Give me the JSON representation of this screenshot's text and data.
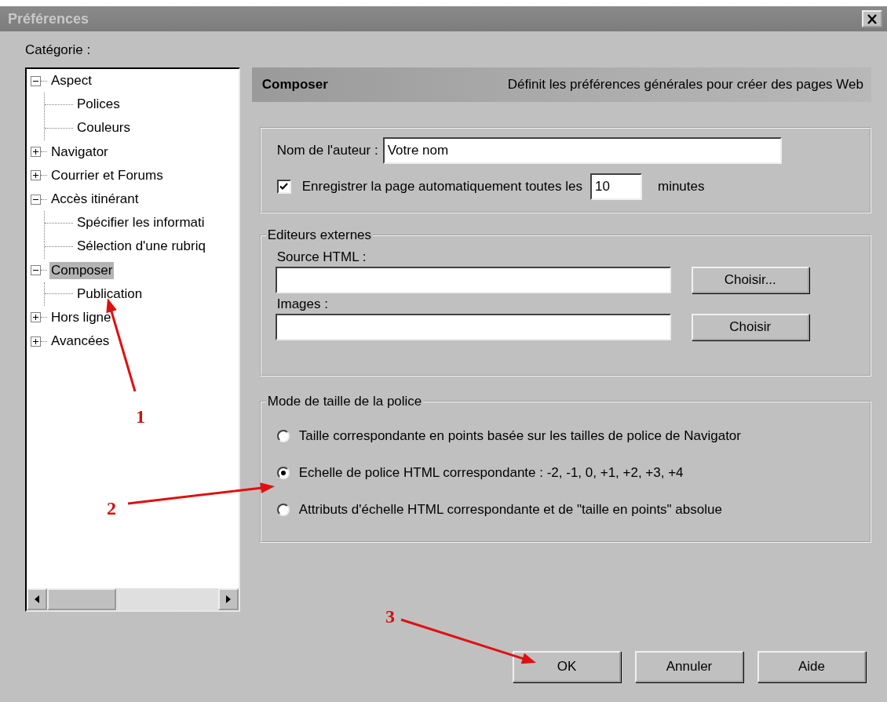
{
  "window": {
    "title": "Préférences"
  },
  "category_label": "Catégorie :",
  "tree": {
    "items": [
      {
        "label": "Aspect",
        "expanded": true,
        "selected": false,
        "children": [
          {
            "label": "Polices",
            "selected": false
          },
          {
            "label": "Couleurs",
            "selected": false
          }
        ]
      },
      {
        "label": "Navigator",
        "expanded": false,
        "selected": false
      },
      {
        "label": "Courrier et Forums",
        "expanded": false,
        "selected": false
      },
      {
        "label": "Accès itinérant",
        "expanded": true,
        "selected": false,
        "children": [
          {
            "label": "Spécifier les informati",
            "selected": false
          },
          {
            "label": "Sélection d'une rubriq",
            "selected": false
          }
        ]
      },
      {
        "label": "Composer",
        "expanded": true,
        "selected": true,
        "children": [
          {
            "label": "Publication",
            "selected": false
          }
        ]
      },
      {
        "label": "Hors ligne",
        "expanded": false,
        "selected": false
      },
      {
        "label": "Avancées",
        "expanded": false,
        "selected": false
      }
    ]
  },
  "header": {
    "title": "Composer",
    "description": "Définit les préférences générales pour créer des pages Web"
  },
  "general": {
    "author_label": "Nom de l'auteur :",
    "author_value": "Votre nom",
    "autosave_label": "Enregistrer la page automatiquement toutes les",
    "autosave_checked": true,
    "autosave_value": "10",
    "autosave_unit": "minutes"
  },
  "external_editors": {
    "legend": "Editeurs externes",
    "fields": [
      {
        "label": "Source HTML :",
        "button": "Choisir..."
      },
      {
        "label": "Images :",
        "button": "Choisir"
      }
    ]
  },
  "font_size_mode": {
    "legend": "Mode de taille de la police",
    "options": [
      {
        "label": "Taille correspondante en points basée sur les tailles de police de Navigator",
        "selected": false
      },
      {
        "label": "Echelle de police HTML correspondante : -2, -1, 0, +1, +2, +3, +4",
        "selected": true
      },
      {
        "label": "Attributs d'échelle HTML correspondante et de \"taille en points\" absolue",
        "selected": false
      }
    ]
  },
  "buttons": [
    "OK",
    "Annuler",
    "Aide"
  ],
  "annotations": [
    {
      "label": "1"
    },
    {
      "label": "2"
    },
    {
      "label": "3"
    }
  ]
}
